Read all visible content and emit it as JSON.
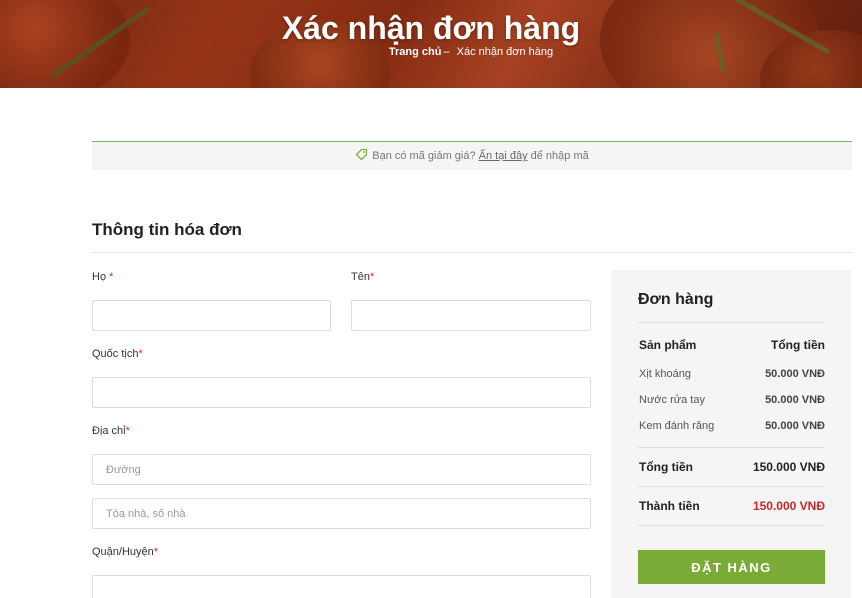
{
  "hero": {
    "title": "Xác nhận đơn hàng",
    "breadcrumb": {
      "home": "Trang chủ",
      "separator": "–",
      "current": "Xác nhận đơn hàng"
    }
  },
  "coupon": {
    "prefix": "Bạn có mã giảm giá?",
    "link": "Ấn tại đây",
    "suffix": "để nhập mã"
  },
  "billing": {
    "title": "Thông tin hóa đơn",
    "last_name": {
      "label": "Họ",
      "required": "*",
      "value": "",
      "placeholder": ""
    },
    "first_name": {
      "label": "Tên",
      "required": "*",
      "value": "",
      "placeholder": ""
    },
    "nationality": {
      "label": "Quốc tịch",
      "required": "*",
      "value": "",
      "placeholder": ""
    },
    "address": {
      "label": "Địa chỉ",
      "required": "*",
      "street_placeholder": "Đường",
      "building_placeholder": "Tòa nhà, số nhà"
    },
    "district": {
      "label": "Quận/Huyện",
      "required": "*",
      "value": "",
      "placeholder": ""
    }
  },
  "order": {
    "title": "Đơn hàng",
    "col_product": "Sản phẩm",
    "col_total": "Tổng tiền",
    "items": [
      {
        "name": "Xịt khoáng",
        "price": "50.000 VNĐ"
      },
      {
        "name": "Nước rửa tay",
        "price": "50.000 VNĐ"
      },
      {
        "name": "Kem đánh răng",
        "price": "50.000 VNĐ"
      }
    ],
    "subtotal_label": "Tổng tiền",
    "subtotal_value": "150.000 VNĐ",
    "final_label": "Thành tiền",
    "final_value": "150.000 VNĐ",
    "place_order": "ĐẶT HÀNG"
  },
  "colors": {
    "accent_green": "#7bab37",
    "price_red": "#c62828",
    "required_red": "#dd2233"
  },
  "icons": {
    "coupon": "tag-icon"
  }
}
